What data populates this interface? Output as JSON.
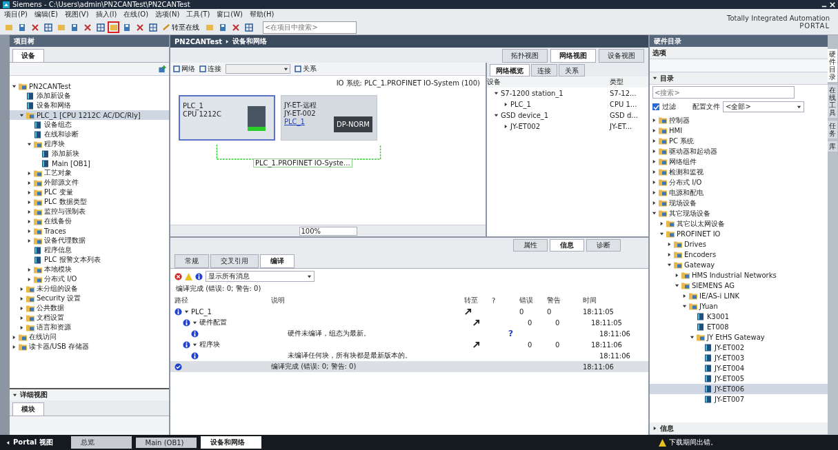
{
  "window": {
    "title": "Siemens - C:\\Users\\admin\\PN2CANTest\\PN2CANTest"
  },
  "menu": [
    "项目(P)",
    "编辑(E)",
    "视图(V)",
    "插入(I)",
    "在线(O)",
    "选项(N)",
    "工具(T)",
    "窗口(W)",
    "帮助(H)"
  ],
  "toolbar": {
    "buttons": [
      {
        "highlighted": false
      },
      {
        "highlighted": false
      },
      {
        "highlighted": false
      },
      {
        "highlighted": false
      },
      {
        "highlighted": false
      },
      {
        "highlighted": false
      },
      {
        "highlighted": false
      },
      {
        "highlighted": false
      },
      {
        "highlighted": true
      },
      {
        "highlighted": false
      },
      {
        "highlighted": false
      },
      {
        "highlighted": false
      },
      {
        "highlighted": false
      },
      {
        "highlighted": false
      },
      {
        "highlighted": false
      },
      {
        "highlighted": false
      }
    ],
    "go_online": "转至在线",
    "search_placeholder": "<在项目中搜索>"
  },
  "brand": {
    "line1": "Totally Integrated Automation",
    "line2": "PORTAL"
  },
  "project_tree": {
    "title": "项目树",
    "tab": "设备",
    "items": [
      {
        "label": "PN2CANTest",
        "expanded": true,
        "selected": false,
        "children": [
          {
            "label": "添加新设备",
            "selected": false
          },
          {
            "label": "设备和网络",
            "selected": false
          },
          {
            "label": "PLC_1 [CPU 1212C AC/DC/Rly]",
            "expanded": true,
            "selected": true,
            "children": [
              {
                "label": "设备组态",
                "selected": false
              },
              {
                "label": "在线和诊断",
                "selected": false
              },
              {
                "label": "程序块",
                "expanded": true,
                "selected": false,
                "children": [
                  {
                    "label": "添加新块",
                    "selected": false
                  },
                  {
                    "label": "Main [OB1]",
                    "selected": false
                  }
                ]
              },
              {
                "label": "工艺对象",
                "expanded": false,
                "selected": false
              },
              {
                "label": "外部源文件",
                "expanded": false,
                "selected": false
              },
              {
                "label": "PLC 变量",
                "expanded": false,
                "selected": false
              },
              {
                "label": "PLC 数据类型",
                "expanded": false,
                "selected": false
              },
              {
                "label": "监控与强制表",
                "expanded": false,
                "selected": false
              },
              {
                "label": "在线备份",
                "expanded": false,
                "selected": false
              },
              {
                "label": "Traces",
                "expanded": false,
                "selected": false
              },
              {
                "label": "设备代理数据",
                "expanded": false,
                "selected": false
              },
              {
                "label": "程序信息",
                "selected": false
              },
              {
                "label": "PLC 报警文本列表",
                "selected": false
              },
              {
                "label": "本地模块",
                "expanded": false,
                "selected": false
              },
              {
                "label": "分布式 I/O",
                "expanded": false,
                "selected": false
              }
            ]
          },
          {
            "label": "未分组的设备",
            "expanded": false,
            "selected": false
          },
          {
            "label": "Security 设置",
            "expanded": false,
            "selected": false
          },
          {
            "label": "公共数据",
            "expanded": false,
            "selected": false
          },
          {
            "label": "文档设置",
            "expanded": false,
            "selected": false
          },
          {
            "label": "语言和资源",
            "expanded": false,
            "selected": false
          }
        ]
      },
      {
        "label": "在线访问",
        "expanded": false,
        "selected": false
      },
      {
        "label": "读卡器/USB 存储器",
        "expanded": false,
        "selected": false
      }
    ],
    "detail_view": {
      "title": "详细视图",
      "tab": "模块"
    }
  },
  "editor": {
    "breadcrumb": [
      "PN2CANTest",
      "设备和网络"
    ],
    "view_tabs": [
      {
        "label": "拓扑视图",
        "selected": false
      },
      {
        "label": "网络视图",
        "selected": true
      },
      {
        "label": "设备视图",
        "selected": false
      }
    ],
    "tools": [
      "网络",
      "连接",
      "关系"
    ],
    "io_system": "IO 系统: PLC_1.PROFINET IO-System (100)",
    "devices": [
      {
        "name": "PLC_1",
        "subtitle": "CPU 1212C",
        "selected": true
      },
      {
        "name": "JY-ET-远程",
        "subtitle": "JY-ET-002",
        "link": "PLC_1",
        "module": "DP-NORM",
        "selected": false
      }
    ],
    "network_label": "PLC_1.PROFINET IO-Syste...",
    "zoom": "100%"
  },
  "overview": {
    "tabs": [
      {
        "label": "网络概览",
        "selected": true
      },
      {
        "label": "连接",
        "selected": false
      },
      {
        "label": "关系",
        "selected": false
      }
    ],
    "columns": [
      "设备",
      "类型"
    ],
    "rows": [
      {
        "device": "S7-1200 station_1",
        "type": "S7-12...",
        "expanded": true,
        "children": [
          {
            "device": "PLC_1",
            "type": "CPU 1...",
            "expanded": false
          }
        ]
      },
      {
        "device": "GSD device_1",
        "type": "GSD d...",
        "expanded": true,
        "children": [
          {
            "device": "JY-ET002",
            "type": "JY-ET...",
            "expanded": false
          }
        ]
      }
    ]
  },
  "inspector": {
    "tabs": [
      {
        "label": "属性",
        "selected": false
      },
      {
        "label": "信息",
        "selected": true
      },
      {
        "label": "诊断",
        "selected": false
      }
    ],
    "subtabs": [
      {
        "label": "常规",
        "selected": false
      },
      {
        "label": "交叉引用",
        "selected": false
      },
      {
        "label": "编译",
        "selected": true
      }
    ],
    "filter": "显示所有消息",
    "summary": "编译完成 (错误: 0; 警告: 0)",
    "columns": [
      "路径",
      "说明",
      "转至",
      "?",
      "错误",
      "警告",
      "时间"
    ],
    "rows": [
      {
        "kind": "info",
        "path": "PLC_1",
        "expanded": true,
        "goto": true,
        "errors": "0",
        "warnings": "0",
        "time": "18:11:05",
        "selected": false,
        "children": [
          {
            "kind": "info",
            "path": "硬件配置",
            "expanded": true,
            "goto": true,
            "errors": "0",
            "warnings": "0",
            "time": "18:11:05",
            "selected": false,
            "children": [
              {
                "kind": "info",
                "description": "硬件未编译，组态为最新。",
                "help": "?",
                "time": "18:11:06",
                "selected": false
              }
            ]
          },
          {
            "kind": "info",
            "path": "程序块",
            "expanded": true,
            "goto": true,
            "errors": "0",
            "warnings": "0",
            "time": "18:11:06",
            "selected": false,
            "children": [
              {
                "kind": "info",
                "description": "未编译任何块，所有块都是最新版本的。",
                "time": "18:11:06",
                "selected": false
              }
            ]
          }
        ]
      },
      {
        "kind": "done",
        "description": "编译完成 (错误: 0; 警告: 0)",
        "time": "18:11:06",
        "selected": true
      }
    ]
  },
  "catalog": {
    "title": "硬件目录",
    "options": "选项",
    "section": "目录",
    "search_placeholder": "<搜索>",
    "filter": {
      "label": "过滤",
      "checked": true
    },
    "profile_label": "配置文件",
    "profile": "<全部>",
    "items": [
      {
        "label": "控制器",
        "expanded": false,
        "selected": false
      },
      {
        "label": "HMI",
        "expanded": false,
        "selected": false
      },
      {
        "label": "PC 系统",
        "expanded": false,
        "selected": false
      },
      {
        "label": "驱动器和起动器",
        "expanded": false,
        "selected": false
      },
      {
        "label": "网络组件",
        "expanded": false,
        "selected": false
      },
      {
        "label": "检测和监视",
        "expanded": false,
        "selected": false
      },
      {
        "label": "分布式 I/O",
        "expanded": false,
        "selected": false
      },
      {
        "label": "电源和配电",
        "expanded": false,
        "selected": false
      },
      {
        "label": "现场设备",
        "expanded": false,
        "selected": false
      },
      {
        "label": "其它现场设备",
        "expanded": true,
        "selected": false,
        "children": [
          {
            "label": "其它以太网设备",
            "expanded": false,
            "selected": false
          },
          {
            "label": "PROFINET IO",
            "expanded": true,
            "selected": false,
            "children": [
              {
                "label": "Drives",
                "expanded": false,
                "selected": false
              },
              {
                "label": "Encoders",
                "expanded": false,
                "selected": false
              },
              {
                "label": "Gateway",
                "expanded": true,
                "selected": false,
                "children": [
                  {
                    "label": "HMS Industrial Networks",
                    "expanded": false,
                    "selected": false
                  },
                  {
                    "label": "SIEMENS AG",
                    "expanded": true,
                    "selected": false,
                    "children": [
                      {
                        "label": "IE/AS-i LINK",
                        "expanded": false,
                        "selected": false
                      },
                      {
                        "label": "JYuan",
                        "expanded": true,
                        "selected": false,
                        "children": [
                          {
                            "label": "K3001",
                            "selected": false
                          },
                          {
                            "label": "ET008",
                            "selected": false
                          },
                          {
                            "label": "JY EtHS Gateway",
                            "expanded": true,
                            "selected": false,
                            "children": [
                              {
                                "label": "JY-ET002",
                                "selected": false
                              },
                              {
                                "label": "JY-ET003",
                                "selected": false
                              },
                              {
                                "label": "JY-ET004",
                                "selected": false
                              },
                              {
                                "label": "JY-ET005",
                                "selected": false
                              },
                              {
                                "label": "JY-ET006",
                                "selected": true
                              },
                              {
                                "label": "JY-ET007",
                                "selected": false
                              }
                            ]
                          }
                        ]
                      }
                    ]
                  }
                ]
              }
            ]
          }
        ]
      }
    ],
    "info": "信息"
  },
  "side_tabs": [
    {
      "label": "硬件目录",
      "selected": true
    },
    {
      "label": "在线工具",
      "selected": false
    },
    {
      "label": "任务",
      "selected": false
    },
    {
      "label": "库",
      "selected": false
    }
  ],
  "taskbar": {
    "portal": "Portal 视图",
    "items": [
      {
        "label": "总览",
        "selected": false
      },
      {
        "label": "Main (OB1)",
        "selected": false
      },
      {
        "label": "设备和网络",
        "selected": true
      }
    ],
    "status": "下载期间出错。"
  }
}
